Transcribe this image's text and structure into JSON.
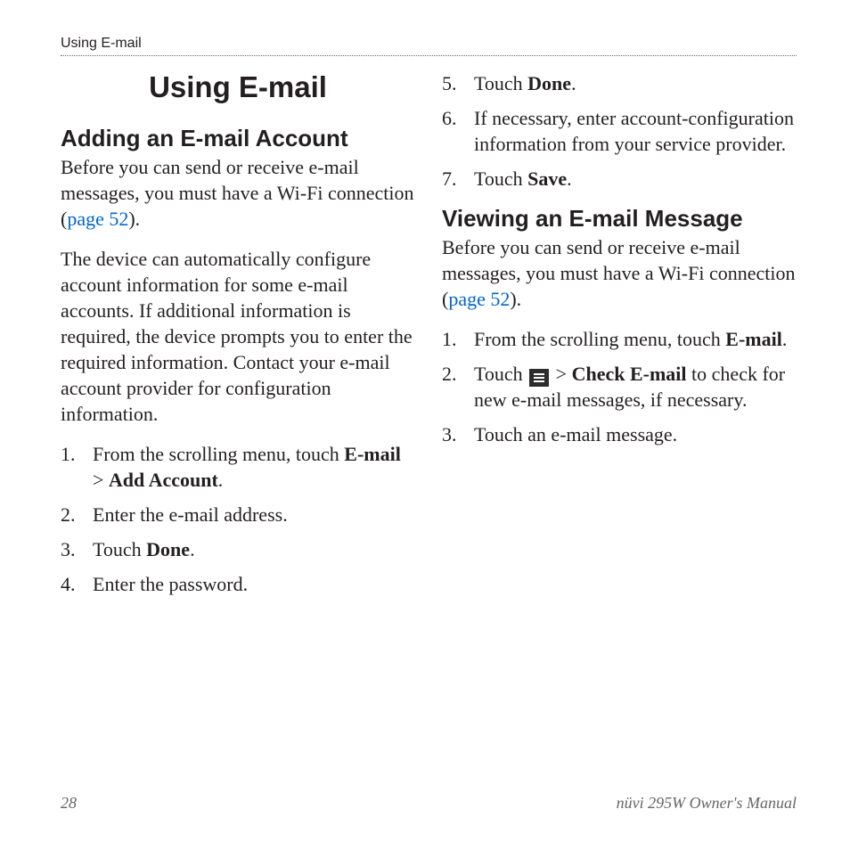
{
  "header": {
    "section_label": "Using E-mail"
  },
  "title": "Using E-mail",
  "left": {
    "h2": "Adding an E-mail Account",
    "p1a": "Before you can send or receive e-mail messages, you must have a Wi-Fi connection (",
    "p1_link": "page 52",
    "p1b": ").",
    "p2": "The device can automatically configure account information for some e-mail accounts. If additional information is required, the device prompts you to enter the required information. Contact your e-mail account provider for configuration information.",
    "steps": {
      "s1a": "From the scrolling menu, touch ",
      "s1b": "E-mail",
      "s1c": " > ",
      "s1d": "Add Account",
      "s1e": ".",
      "s2": "Enter the e-mail address.",
      "s3a": "Touch ",
      "s3b": "Done",
      "s3c": ".",
      "s4": "Enter the password."
    }
  },
  "right": {
    "steps1": {
      "s5a": "Touch ",
      "s5b": "Done",
      "s5c": ".",
      "s6": "If necessary, enter account-configuration information from your service provider.",
      "s7a": "Touch ",
      "s7b": "Save",
      "s7c": "."
    },
    "h2": "Viewing an E-mail Message",
    "p1a": "Before you can send or receive e-mail messages, you must have a Wi-Fi connection (",
    "p1_link": "page 52",
    "p1b": ").",
    "steps2": {
      "s1a": "From the scrolling menu, touch ",
      "s1b": "E-mail",
      "s1c": ".",
      "s2a": "Touch ",
      "s2b": " > ",
      "s2c": "Check E-mail",
      "s2d": " to check for new e-mail messages, if necessary.",
      "s3": "Touch an e-mail message."
    }
  },
  "footer": {
    "page": "28",
    "manual": "nüvi 295W Owner's Manual"
  }
}
